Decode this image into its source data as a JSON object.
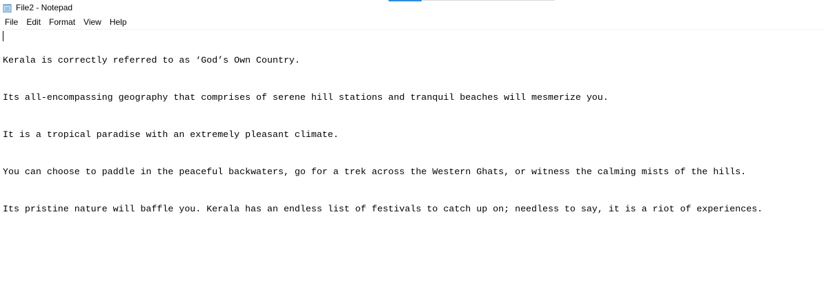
{
  "window": {
    "title": "File2 - Notepad",
    "icon": "notepad-icon"
  },
  "menu": {
    "items": [
      "File",
      "Edit",
      "Format",
      "View",
      "Help"
    ]
  },
  "editor": {
    "lines": [
      "Kerala is correctly referred to as ‘God’s Own Country.",
      "Its all-encompassing geography that comprises of serene hill stations and tranquil beaches will mesmerize you.",
      "It is a tropical paradise with an extremely pleasant climate.",
      "You can choose to paddle in the peaceful backwaters, go for a trek across the Western Ghats, or witness the calming mists of the hills.",
      "Its pristine nature will baffle you. Kerala has an endless list of festivals to catch up on; needless to say, it is a riot of experiences."
    ]
  }
}
